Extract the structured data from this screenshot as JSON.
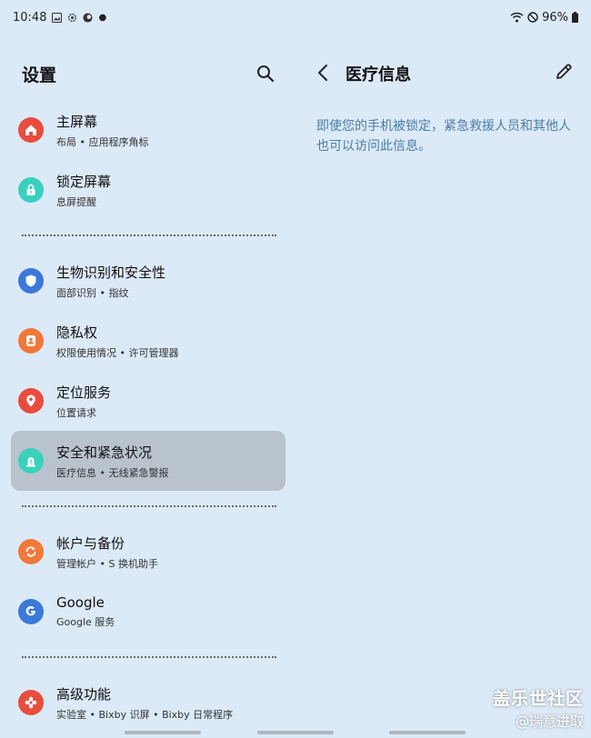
{
  "status": {
    "time": "10:48",
    "battery": "96%"
  },
  "left": {
    "title": "设置",
    "items": [
      {
        "title": "主屏幕",
        "subtitle": "布局 • 应用程序角标",
        "icon": "home-icon",
        "color": "#e84c3d"
      },
      {
        "title": "锁定屏幕",
        "subtitle": "息屏提醒",
        "icon": "lock-icon",
        "color": "#39d1bd"
      },
      {
        "title": "生物识别和安全性",
        "subtitle": "面部识别 • 指纹",
        "icon": "shield-icon",
        "color": "#3b78d8"
      },
      {
        "title": "隐私权",
        "subtitle": "权限使用情况 • 许可管理器",
        "icon": "privacy-icon",
        "color": "#f0793a"
      },
      {
        "title": "定位服务",
        "subtitle": "位置请求",
        "icon": "location-pin-icon",
        "color": "#e84c3d"
      },
      {
        "title": "安全和紧急状况",
        "subtitle": "医疗信息 • 无线紧急警报",
        "icon": "emergency-icon",
        "color": "#39d1bd"
      },
      {
        "title": "帐户与备份",
        "subtitle": "管理帐户 • S 换机助手",
        "icon": "sync-icon",
        "color": "#f0793a"
      },
      {
        "title": "Google",
        "subtitle": "Google 服务",
        "icon": "google-icon",
        "color": "#3b78d8"
      },
      {
        "title": "高级功能",
        "subtitle": "实验室 • Bixby 识屏 • Bixby 日常程序",
        "icon": "gear-flower-icon",
        "color": "#e84c3d"
      }
    ]
  },
  "right": {
    "title": "医疗信息",
    "description": "即使您的手机被锁定，紧急救援人员和其他人也可以访问此信息。"
  },
  "watermark": {
    "line1": "盖乐世社区",
    "line2": "@瑞意进取"
  }
}
